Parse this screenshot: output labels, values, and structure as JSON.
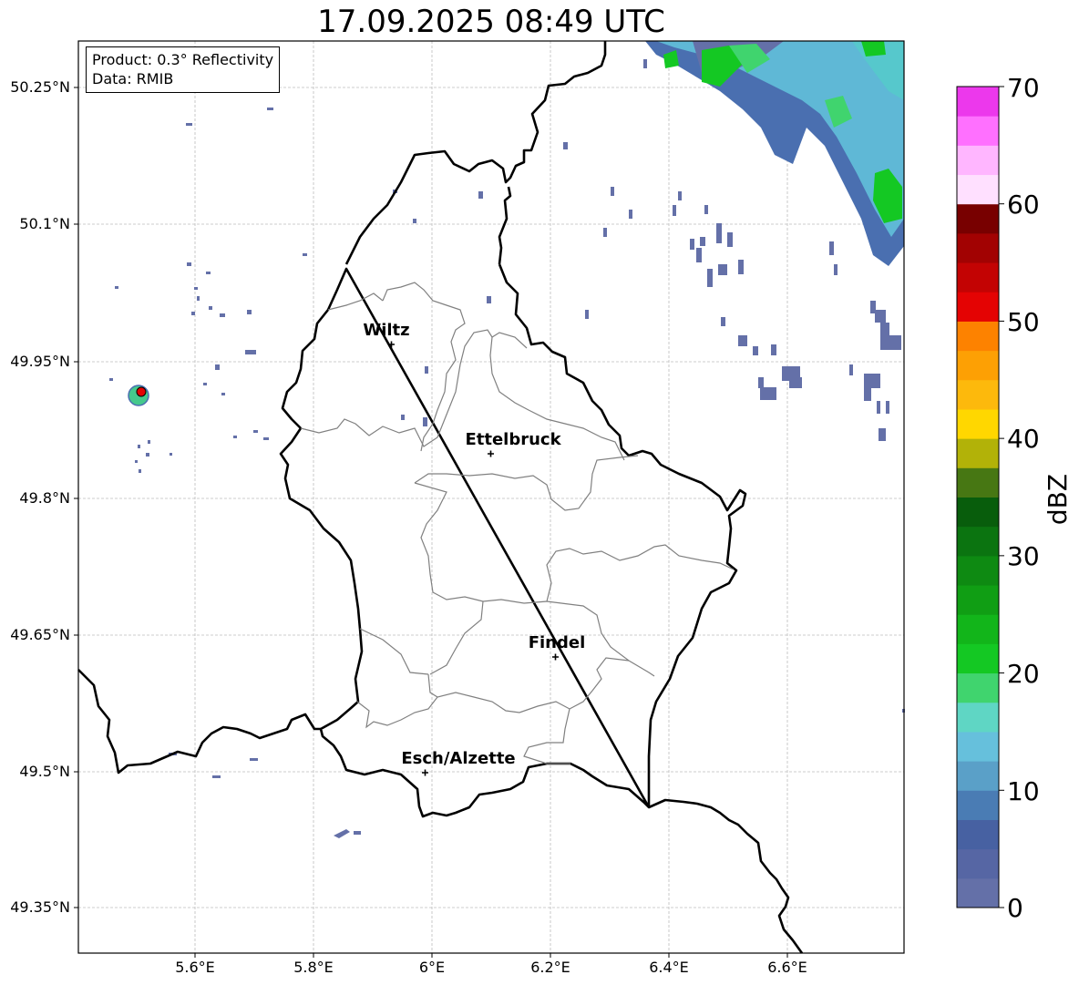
{
  "title": "17.09.2025 08:49 UTC",
  "info": {
    "product": "Product: 0.3° Reflectivity",
    "source": "Data: RMIB"
  },
  "axes": {
    "lon_ticks": [
      "5.6°E",
      "5.8°E",
      "6°E",
      "6.2°E",
      "6.4°E",
      "6.6°E"
    ],
    "lat_ticks": [
      "50.25°N",
      "50.1°N",
      "49.95°N",
      "49.8°N",
      "49.65°N",
      "49.5°N",
      "49.35°N"
    ]
  },
  "cities": [
    {
      "name": "Wiltz",
      "lon": 5.93,
      "lat": 49.97
    },
    {
      "name": "Ettelbruck",
      "lon": 6.1,
      "lat": 49.85
    },
    {
      "name": "Findel",
      "lon": 6.21,
      "lat": 49.63
    },
    {
      "name": "Esch/Alzette",
      "lon": 5.99,
      "lat": 49.5
    }
  ],
  "radar_site": {
    "lon": 5.51,
    "lat": 49.91
  },
  "colorbar": {
    "label": "dBZ",
    "ticks": [
      "0",
      "10",
      "20",
      "30",
      "40",
      "50",
      "60",
      "70"
    ],
    "range": [
      0,
      70
    ],
    "colors": [
      "#6470a8",
      "#5666a4",
      "#4761a2",
      "#4a7cb4",
      "#5aa0c8",
      "#66c0dc",
      "#5fd6c4",
      "#40d46e",
      "#14c823",
      "#12b51a",
      "#109e14",
      "#0e8a12",
      "#0b7410",
      "#085d0c",
      "#477713",
      "#b2b208",
      "#ffd700",
      "#fdb90c",
      "#fda004",
      "#fd8200",
      "#e40303",
      "#c30303",
      "#a20202",
      "#780000",
      "#ffe0ff",
      "#ffb6ff",
      "#ff70ff",
      "#ec38ec"
    ]
  }
}
